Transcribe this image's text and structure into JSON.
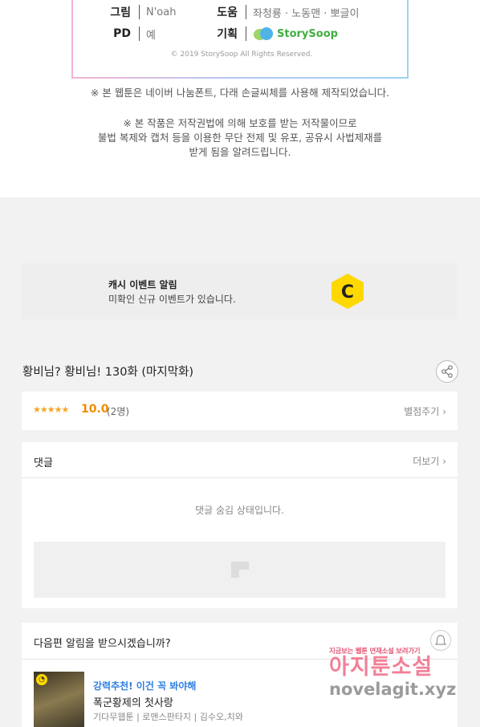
{
  "credits": {
    "row1": {
      "role1": "그림",
      "name1": "N'oah",
      "role2": "도움",
      "name2": "좌청룡 · 노동맨 · 뽀글이"
    },
    "row2": {
      "role1": "PD",
      "name1": "예",
      "role2": "기획",
      "name2": "StorySoop"
    },
    "copyright": "© 2019 StorySoop All Rights Reserved."
  },
  "notices": {
    "font_notice": "※ 본 웹툰은 네이버 나눔폰트, 다래 손글씨체를 사용해 제작되었습니다.",
    "copyright_notice_1": "※ 본 작품은 저작권법에 의해 보호를 받는 저작물이므로",
    "copyright_notice_2": "불법 복제와 캡처 등을 이용한 무단 전제 및 유포, 공유시 사법제재를",
    "copyright_notice_3": "받게 됨을 알려드립니다."
  },
  "cash_event": {
    "title": "캐시 이벤트 알림",
    "subtitle": "미확인 신규 이벤트가 있습니다.",
    "logo_letter": "C",
    "logo_color": "#ffd800"
  },
  "episode": {
    "title": "황비님? 황비님! 130화 (마지막화)"
  },
  "rating": {
    "stars": "★★★★★",
    "score": "10.0",
    "count": "(2명)",
    "rate_button": "별점주기"
  },
  "comments": {
    "title": "댓글",
    "more": "더보기",
    "hidden_message": "댓글 숨김 상태입니다."
  },
  "next_notice": {
    "title": "다음편 알림을 받으시겠습니까?",
    "recommend_label": "강력추천! 이건 꼭 봐야해",
    "recommend_title": "폭군황제의 첫사랑",
    "recommend_meta": "기다무웹툰 | 로맨스판타지 | 김수오,치와"
  },
  "watermark": {
    "top": "지금보는 웹툰 연재소설 보려가기",
    "main": "아지툰소설",
    "url": "novelagit.xyz"
  },
  "colors": {
    "accent_orange": "#f08c00",
    "link_blue": "#2f7fe0",
    "storysoop_green": "#3fae3f"
  }
}
